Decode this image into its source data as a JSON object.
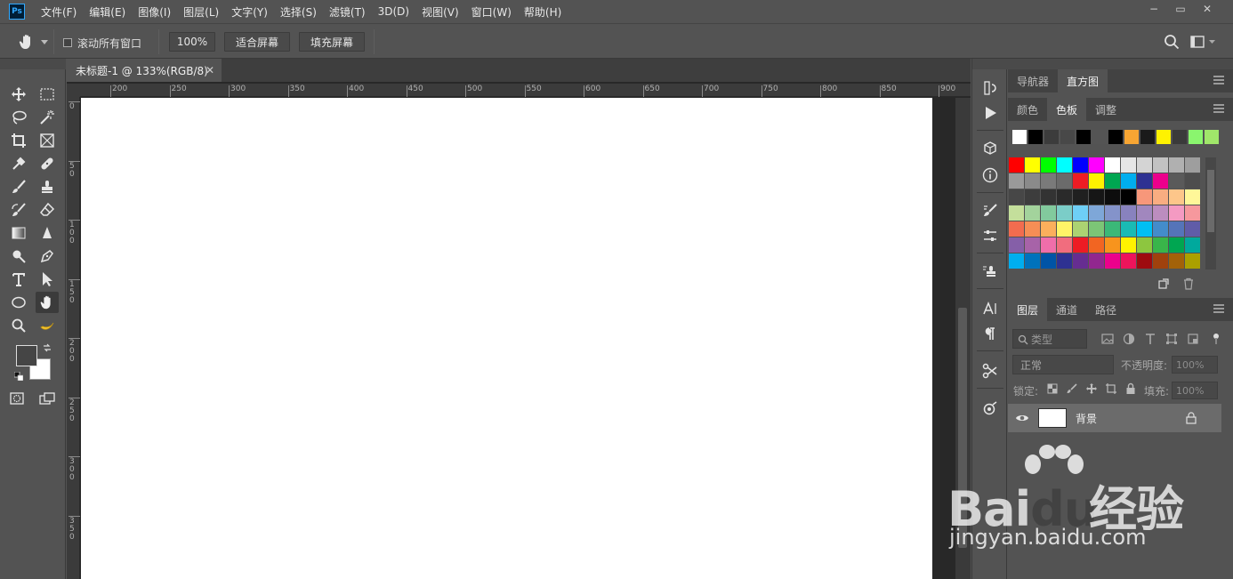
{
  "app": {
    "logo": "Ps"
  },
  "menu": [
    "文件(F)",
    "编辑(E)",
    "图像(I)",
    "图层(L)",
    "文字(Y)",
    "选择(S)",
    "滤镜(T)",
    "3D(D)",
    "视图(V)",
    "窗口(W)",
    "帮助(H)"
  ],
  "window_controls": [
    "−",
    "▭",
    "✕"
  ],
  "options": {
    "scroll_all_label": "滚动所有窗口",
    "zoom_value": "100%",
    "fit_screen_label": "适合屏幕",
    "fill_screen_label": "填充屏幕"
  },
  "document": {
    "tab_title": "未标题-1 @ 133%(RGB/8)",
    "close_glyph": "✕",
    "ruler_h_ticks": [
      "200",
      "250",
      "300",
      "350",
      "400",
      "450",
      "500",
      "550",
      "600",
      "650",
      "700",
      "750",
      "800",
      "850",
      "900"
    ],
    "ruler_v_ticks": [
      "0",
      "5\n0",
      "1\n0\n0",
      "1\n5\n0",
      "2\n0\n0",
      "2\n5\n0",
      "3\n0\n0",
      "3\n5\n0"
    ]
  },
  "panels": {
    "top_tabs": [
      "导航器",
      "直方图"
    ],
    "top_active": "直方图",
    "color_tabs": [
      "颜色",
      "色板",
      "调整"
    ],
    "color_active": "色板",
    "layer_tabs": [
      "图层",
      "通道",
      "路径"
    ],
    "layer_active": "图层"
  },
  "recent_swatches": [
    "#ffffff",
    "#000000",
    "#3c3c3c",
    "#484848",
    "#000000",
    "#545454",
    "#000000",
    "#f7a533",
    "#1a1a1a",
    "#fff200",
    "#3a3a3a",
    "#8af56e",
    "#a0e66a"
  ],
  "swatches": [
    "#ff0000",
    "#ffff00",
    "#00ff00",
    "#00ffff",
    "#0000ff",
    "#ff00ff",
    "#ffffff",
    "#e6e6e6",
    "#d4d4d4",
    "#c2c2c2",
    "#b0b0b0",
    "#9e9e9e",
    "#9a9a9a",
    "#8a8a8a",
    "#7a7a7a",
    "#6b6b6b",
    "#ed1c24",
    "#fff200",
    "#00a651",
    "#00aeef",
    "#2e3192",
    "#ec008c",
    "#5a5a5a",
    "#4d4d4d",
    "#474747",
    "#3d3d3d",
    "#333333",
    "#2a2a2a",
    "#202020",
    "#161616",
    "#0d0d0d",
    "#000000",
    "#f7977a",
    "#f9ad81",
    "#fdc68a",
    "#fff799",
    "#c4df9b",
    "#a3d39c",
    "#82ca9d",
    "#7bcdc8",
    "#6ecff6",
    "#7ea7d8",
    "#8493ca",
    "#8882be",
    "#a187be",
    "#bc8dbf",
    "#f49ac2",
    "#f6989d",
    "#f26c4f",
    "#f68e55",
    "#fbaf5c",
    "#fff467",
    "#acd372",
    "#7cc576",
    "#3bb878",
    "#1abbb4",
    "#00bff3",
    "#438ccb",
    "#5574b9",
    "#605ca8",
    "#855fa8",
    "#a763a8",
    "#f06eaa",
    "#f16d7e",
    "#ed1c24",
    "#f26522",
    "#f7941d",
    "#fff200",
    "#8dc63f",
    "#39b54a",
    "#00a651",
    "#00a99d",
    "#00aeef",
    "#0072bc",
    "#0054a6",
    "#2e3192",
    "#662d91",
    "#92278f",
    "#ec008c",
    "#ed145b",
    "#9e0b0f",
    "#a0410d",
    "#a36209",
    "#aba000"
  ],
  "layers": {
    "search_placeholder": "类型",
    "blend_mode": "正常",
    "opacity_label": "不透明度:",
    "opacity_value": "100%",
    "lock_label": "锁定:",
    "fill_label": "填充:",
    "fill_value": "100%",
    "items": [
      {
        "name": "背景"
      }
    ]
  },
  "watermark": {
    "brand": "Bai",
    "brand2": "du",
    "cn": "经验",
    "url": "jingyan.baidu.com"
  },
  "colors": {
    "ui_bg": "#535353",
    "canvas": "#ffffff",
    "workspace": "#282828",
    "accent": "#31a8ff"
  }
}
